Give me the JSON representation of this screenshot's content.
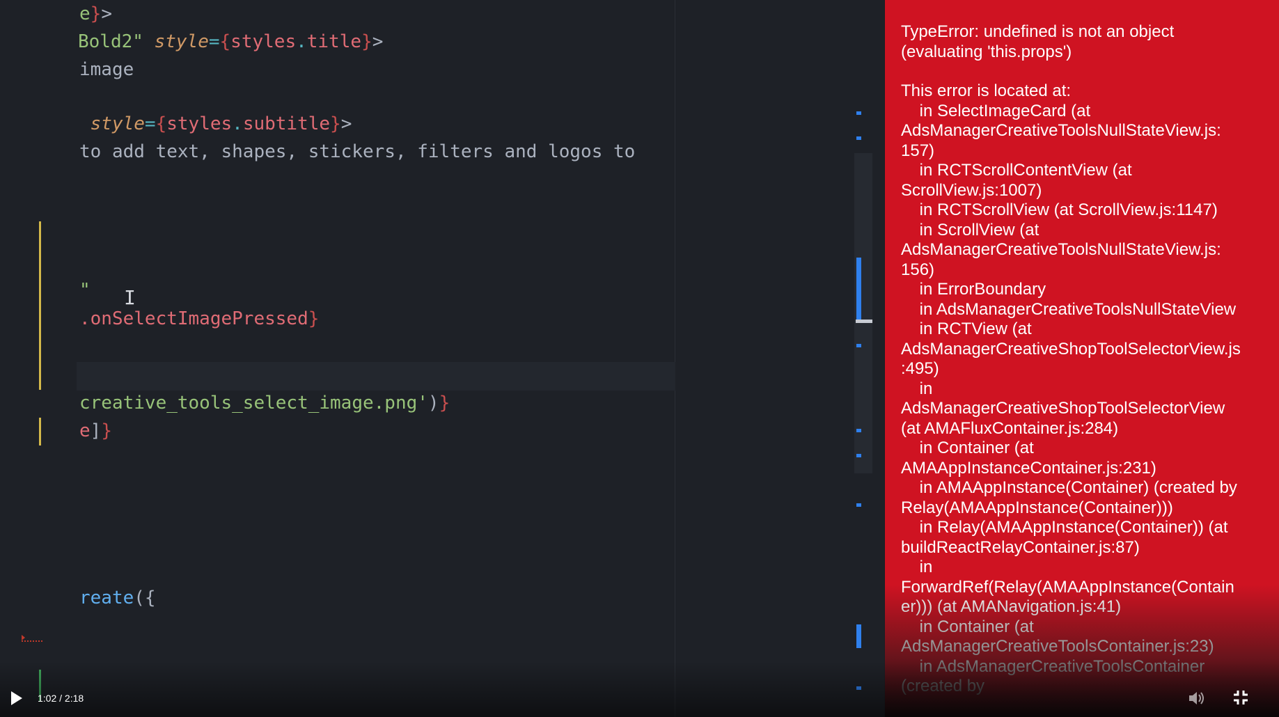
{
  "editor": {
    "lines": [
      {
        "parts": [
          {
            "t": "e",
            "c": "c-str"
          },
          {
            "t": "}",
            "c": "c-brace"
          },
          {
            "t": ">",
            "c": "c-txt"
          }
        ]
      },
      {
        "parts": [
          {
            "t": "Bold2\"",
            "c": "c-str"
          },
          {
            "t": " ",
            "c": "c-txt"
          },
          {
            "t": "style",
            "c": "c-attr"
          },
          {
            "t": "=",
            "c": "c-op"
          },
          {
            "t": "{",
            "c": "c-brace"
          },
          {
            "t": "styles",
            "c": "c-var"
          },
          {
            "t": ".",
            "c": "c-op"
          },
          {
            "t": "title",
            "c": "c-var"
          },
          {
            "t": "}",
            "c": "c-brace"
          },
          {
            "t": ">",
            "c": "c-txt"
          }
        ]
      },
      {
        "parts": [
          {
            "t": "image",
            "c": "c-txt"
          }
        ]
      },
      {
        "parts": [
          {
            "t": " style",
            "c": "c-attr"
          },
          {
            "t": "=",
            "c": "c-op"
          },
          {
            "t": "{",
            "c": "c-brace"
          },
          {
            "t": "styles",
            "c": "c-var"
          },
          {
            "t": ".",
            "c": "c-op"
          },
          {
            "t": "subtitle",
            "c": "c-var"
          },
          {
            "t": "}",
            "c": "c-brace"
          },
          {
            "t": ">",
            "c": "c-txt"
          }
        ]
      },
      {
        "parts": [
          {
            "t": "to add text, shapes, stickers, filters and logos to",
            "c": "c-txt"
          }
        ]
      },
      {
        "parts": [
          {
            "t": "\"",
            "c": "c-str"
          }
        ]
      },
      {
        "parts": [
          {
            "t": ".onSelectImagePressed",
            "c": "c-var"
          },
          {
            "t": "}",
            "c": "c-brace"
          }
        ]
      },
      {
        "parts": [
          {
            "t": "creative_tools_select_image.png'",
            "c": "c-str"
          },
          {
            "t": ")",
            "c": "c-txt"
          },
          {
            "t": "}",
            "c": "c-brace"
          }
        ]
      },
      {
        "parts": [
          {
            "t": "e",
            "c": "c-var"
          },
          {
            "t": "]",
            "c": "c-txt"
          },
          {
            "t": "}",
            "c": "c-brace"
          }
        ]
      },
      {
        "parts": [
          {
            "t": "reate",
            "c": "c-fn"
          },
          {
            "t": "({",
            "c": "c-txt"
          }
        ]
      }
    ]
  },
  "error": {
    "lines": [
      "TypeError: undefined is not an object",
      "(evaluating 'this.props')",
      "",
      "This error is located at:",
      "    in SelectImageCard (at",
      "AdsManagerCreativeToolsNullStateView.js:",
      "157)",
      "    in RCTScrollContentView (at",
      "ScrollView.js:1007)",
      "    in RCTScrollView (at ScrollView.js:1147)",
      "    in ScrollView (at",
      "AdsManagerCreativeToolsNullStateView.js:",
      "156)",
      "    in ErrorBoundary",
      "    in AdsManagerCreativeToolsNullStateView",
      "    in RCTView (at",
      "AdsManagerCreativeShopToolSelectorView.js",
      ":495)",
      "    in",
      "AdsManagerCreativeShopToolSelectorView",
      "(at AMAFluxContainer.js:284)",
      "    in Container (at",
      "AMAAppInstanceContainer.js:231)",
      "    in AMAAppInstance(Container) (created by",
      "Relay(AMAAppInstance(Container)))",
      "    in Relay(AMAAppInstance(Container)) (at",
      "buildReactRelayContainer.js:87)",
      "    in",
      "ForwardRef(Relay(AMAAppInstance(Contain",
      "er))) (at AMANavigation.js:41)",
      "    in Container (at",
      "AdsManagerCreativeToolsContainer.js:23)",
      "    in AdsManagerCreativeToolsContainer",
      "(created by"
    ]
  },
  "player": {
    "time": "1:02 / 2:18",
    "progress_fraction": 0.4493,
    "icons": {
      "play": "play-icon",
      "volume": "volume-icon",
      "fullscreen": "exit-fullscreen-icon"
    }
  }
}
